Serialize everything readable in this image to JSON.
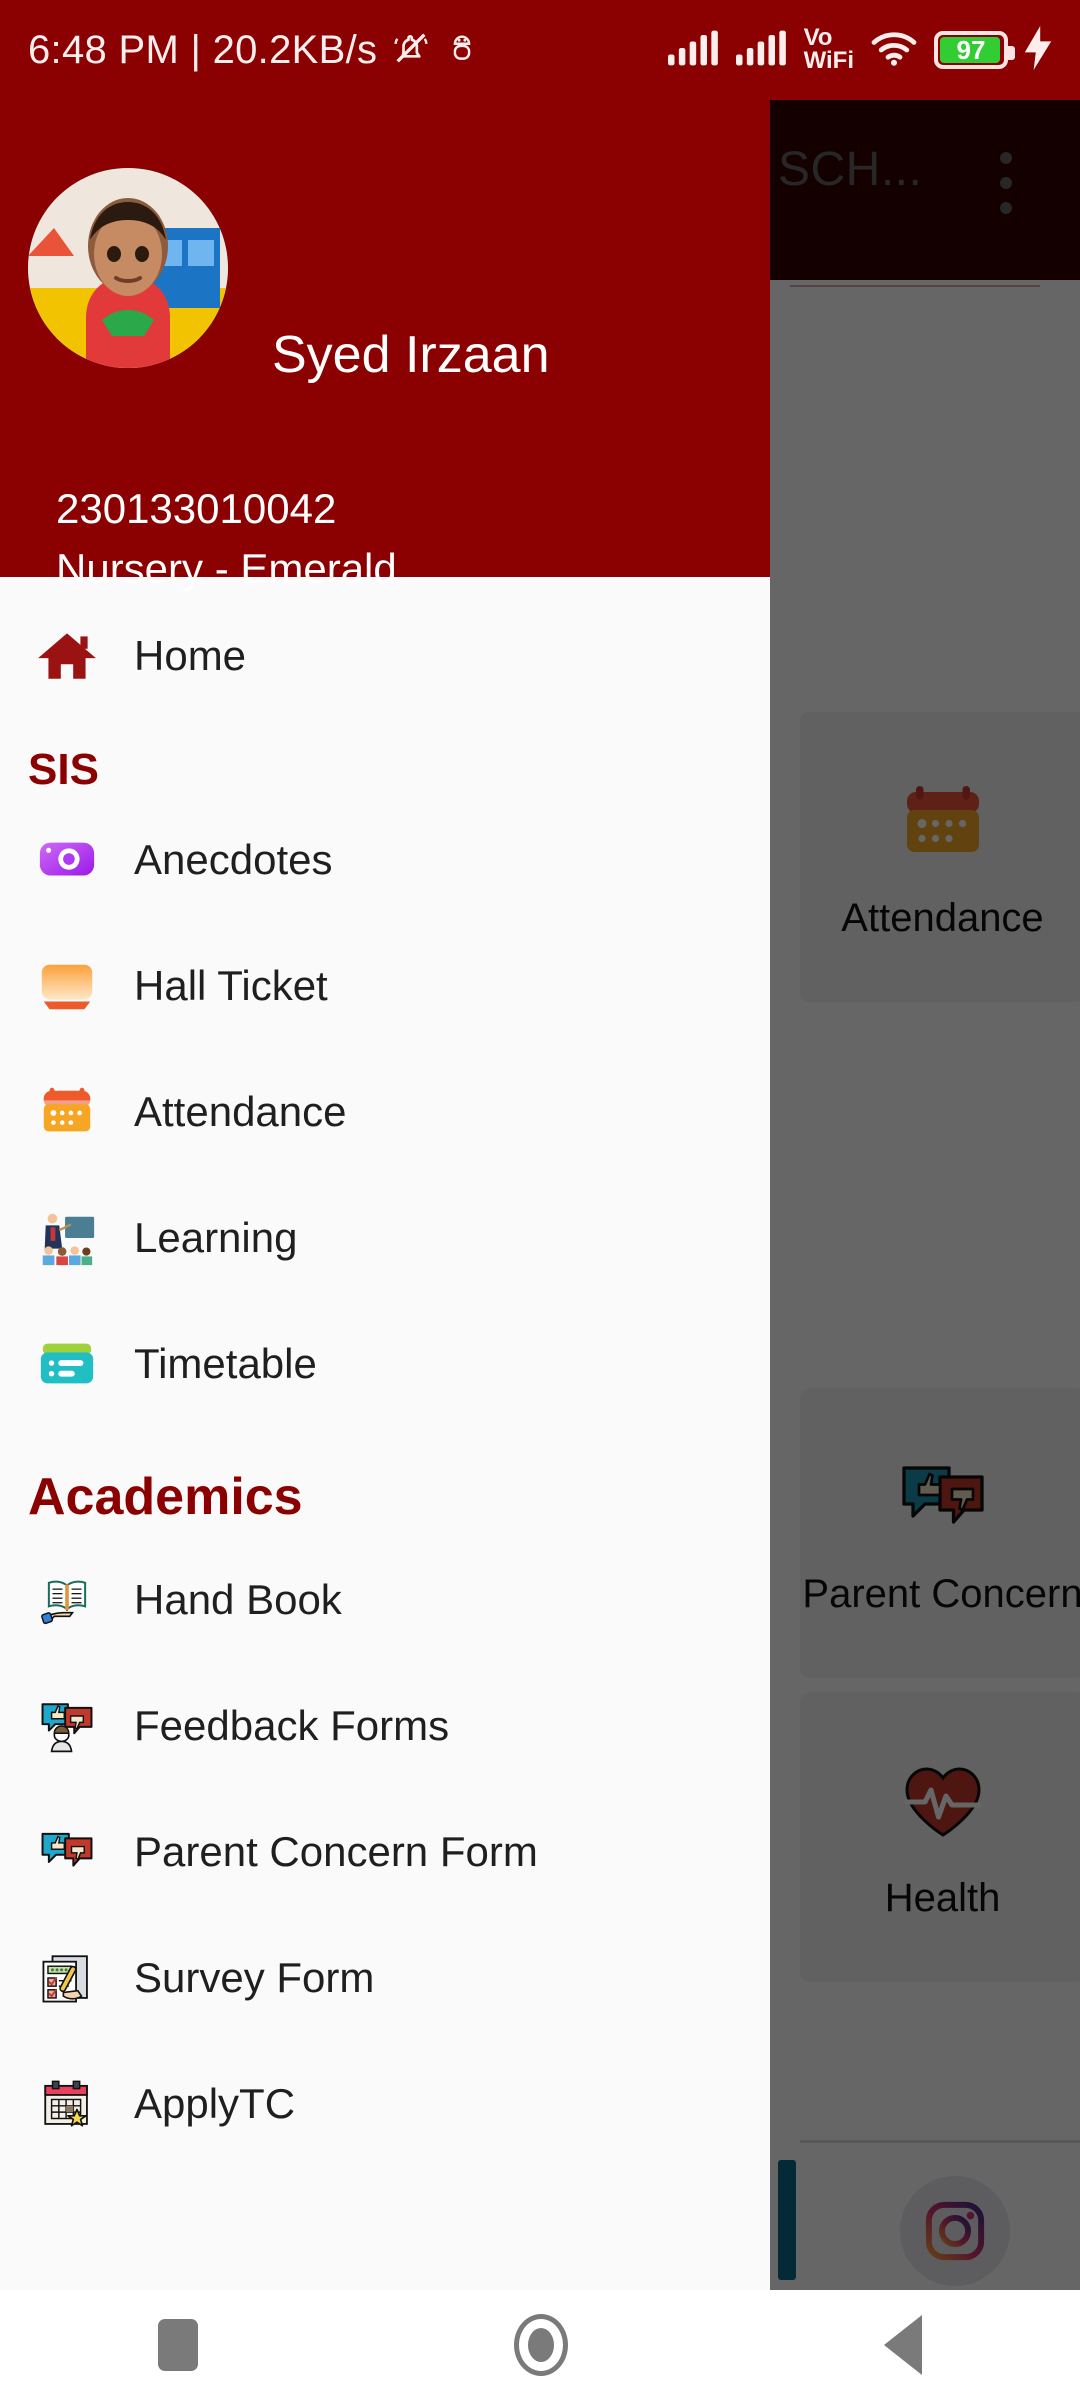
{
  "status_bar": {
    "clock_and_net": "6:48 PM | 20.2KB/s",
    "icons": [
      "bell-muted-icon",
      "bug-icon",
      "signal-bars-icon",
      "signal-bars-icon",
      "vowifi-icon",
      "wifi-icon"
    ],
    "vowifi_line1": "Vo",
    "vowifi_line2": "WiFi",
    "battery_percent": "97",
    "charging": true,
    "bar_color": "#8B0000",
    "battery_color": "#32CD32"
  },
  "background_app": {
    "appbar_title": "SCH...",
    "overflow_icon": "three-dot-menu-icon",
    "tiles": [
      {
        "label": "Attendance",
        "icon": "calendar-icon"
      },
      {
        "label": "Parent Concern",
        "icon": "feedback-bubbles-icon"
      },
      {
        "label": "Health",
        "icon": "heart-pulse-icon"
      }
    ],
    "social": [
      {
        "name": "facebook-icon"
      },
      {
        "name": "instagram-icon"
      }
    ]
  },
  "drawer": {
    "accent_color": "#8B0000",
    "background_color": "#FAFAFA",
    "profile": {
      "avatar": "student-photo-avatar",
      "name": "Syed Irzaan",
      "admission_number": "230133010042",
      "class_section": "Nursery - Emerald"
    },
    "home": {
      "label": "Home",
      "icon": "home-icon"
    },
    "sections": [
      {
        "title": "SIS",
        "items": [
          {
            "label": "Anecdotes",
            "icon": "camera-icon"
          },
          {
            "label": "Hall Ticket",
            "icon": "ticket-card-icon"
          },
          {
            "label": "Attendance",
            "icon": "calendar-icon"
          },
          {
            "label": "Learning",
            "icon": "teacher-classroom-icon"
          },
          {
            "label": "Timetable",
            "icon": "timetable-list-icon"
          }
        ]
      },
      {
        "title": "Academics",
        "items": [
          {
            "label": "Hand Book",
            "icon": "open-book-hand-icon"
          },
          {
            "label": "Feedback Forms",
            "icon": "feedback-person-icon"
          },
          {
            "label": "Parent Concern Form",
            "icon": "feedback-bubbles-icon"
          },
          {
            "label": "Survey Form",
            "icon": "survey-clipboard-icon"
          },
          {
            "label": "ApplyTC",
            "icon": "calendar-star-icon"
          }
        ]
      }
    ]
  },
  "system_nav": {
    "recents": "square-recents-icon",
    "home": "circle-home-icon",
    "back": "triangle-back-icon"
  }
}
